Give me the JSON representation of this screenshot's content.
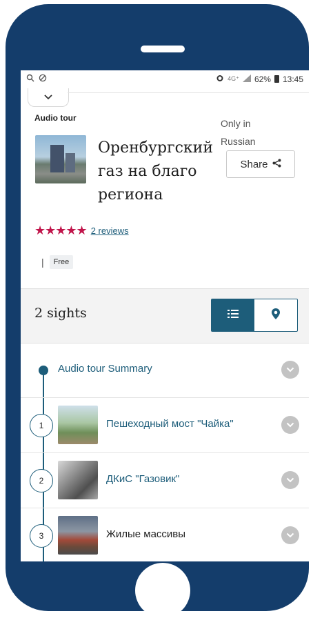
{
  "statusbar": {
    "left_icons": [
      "search-icon",
      "shield-icon"
    ],
    "alarm_icon": "alarm-icon",
    "network": "4G⁺",
    "battery": "62%",
    "time": "13:45"
  },
  "tour": {
    "type": "Audio tour",
    "language_note": "Only in Russian",
    "title": "Оренбургский газ на благо региона",
    "share_label": "Share",
    "rating_stars": 5,
    "stars_text": "★★★★★",
    "reviews_label": "2 reviews",
    "price_sep": "|",
    "price_label": "Free"
  },
  "sights": {
    "count_label": "2 sights",
    "view_list_icon": "list-icon",
    "view_map_icon": "map-pin-icon",
    "active_view": "list"
  },
  "list": {
    "summary_label": "Audio tour Summary",
    "items": [
      {
        "number": "1",
        "label": "Пешеходный мост \"Чайка\""
      },
      {
        "number": "2",
        "label": "ДКиС \"Газовик\""
      },
      {
        "number": "3",
        "label": "Жилые массивы"
      }
    ]
  },
  "colors": {
    "frame": "#143d6b",
    "accent": "#1d5d7a",
    "stars": "#c0144a"
  }
}
